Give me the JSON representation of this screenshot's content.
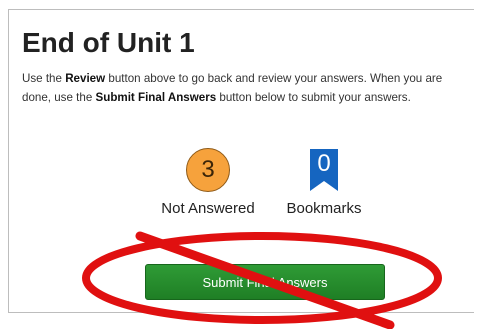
{
  "page": {
    "title": "End of Unit 1",
    "instructions": {
      "part1": "Use the ",
      "review_label": "Review",
      "part2": " button above to go back and review your answers. When you are done, use the ",
      "submit_label": "Submit Final Answers",
      "part3": " button below to submit your answers."
    }
  },
  "summary": {
    "not_answered": {
      "count": "3",
      "label": "Not Answered"
    },
    "bookmarks": {
      "count": "0",
      "label": "Bookmarks"
    }
  },
  "submit_button": {
    "label": "Submit Final Answers"
  },
  "colors": {
    "badge_orange": "#f6a23c",
    "bookmark_blue": "#1565c0",
    "submit_green": "#228b2a",
    "annotation_red": "#e01010"
  },
  "annotation": {
    "icon": "prohibition-icon"
  }
}
